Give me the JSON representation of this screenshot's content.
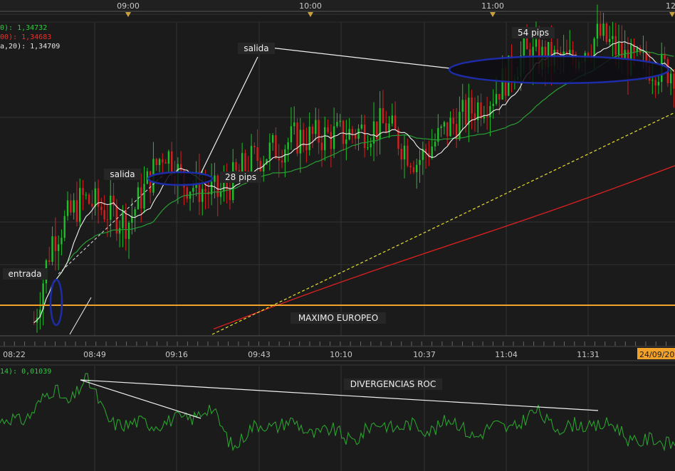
{
  "top_axis": {
    "ticks": [
      "09:00",
      "10:00",
      "11:00",
      "12"
    ]
  },
  "legend": [
    {
      "text": "0): 1,34732",
      "color": "#2ecc40"
    },
    {
      "text": "00): 1,34683",
      "color": "#e8322c"
    },
    {
      "text": "a,20): 1,34709",
      "color": "#e6e6e6"
    }
  ],
  "annotations": {
    "entrada": "entrada",
    "salida_1": "salida",
    "salida_2": "salida",
    "pips_28": "28 pips",
    "pips_54": "54 pips",
    "maximo": "MAXIMO EUROPEO",
    "divergencias": "DIVERGENCIAS ROC"
  },
  "bottom_axis": {
    "ticks": [
      "08:22",
      "08:49",
      "09:16",
      "09:43",
      "10:10",
      "10:37",
      "11:04",
      "11:31"
    ],
    "date_tag": "24/09/20"
  },
  "indicator": {
    "label": "14): 0,01039"
  },
  "colors": {
    "background": "#1b1b1b",
    "grid": "#333333",
    "bull": "#1fbf2a",
    "bear": "#d41f1f",
    "sma_fast": "#f2f2f2",
    "sma_mid": "#2a9d35",
    "sma_slow": "#d42020",
    "level": "#f2a22a",
    "roc": "#2aa12e",
    "ellipse": "#1d2ca8",
    "date_tag": "#f2a22a"
  },
  "chart_data": [
    {
      "type": "candlestick",
      "title": "",
      "x_ticks": [
        "08:22",
        "08:49",
        "09:16",
        "09:43",
        "10:10",
        "10:37",
        "11:04",
        "11:31"
      ],
      "top_ticks": [
        "09:00",
        "10:00",
        "11:00",
        "12"
      ],
      "price_path": [
        [
          "08:29",
          1.339
        ],
        [
          "08:35",
          1.3415
        ],
        [
          "08:45",
          1.3427
        ],
        [
          "09:00",
          1.342
        ],
        [
          "09:12",
          1.3442
        ],
        [
          "09:18",
          1.3432
        ],
        [
          "09:30",
          1.3428
        ],
        [
          "09:40",
          1.3438
        ],
        [
          "09:55",
          1.3445
        ],
        [
          "10:10",
          1.3446
        ],
        [
          "10:25",
          1.3449
        ],
        [
          "10:35",
          1.3438
        ],
        [
          "10:45",
          1.3448
        ],
        [
          "11:00",
          1.3458
        ],
        [
          "11:10",
          1.347
        ],
        [
          "11:25",
          1.3468
        ],
        [
          "11:35",
          1.3476
        ],
        [
          "11:45",
          1.3468
        ],
        [
          "11:55",
          1.3466
        ],
        [
          "12:02",
          1.3465
        ]
      ],
      "series": [
        {
          "name": "0)",
          "last": 1.34732
        },
        {
          "name": "00)",
          "last": 1.34683
        },
        {
          "name": "a,20)",
          "last": 1.34709
        }
      ],
      "annotations": [
        "entrada",
        "salida",
        "salida",
        "28 pips",
        "54 pips",
        "MAXIMO EUROPEO"
      ],
      "grid": true
    },
    {
      "type": "line",
      "series": [
        {
          "name": "14)",
          "last": 0.01039,
          "values": [
            [
              "08:24",
              -0.002
            ],
            [
              "08:30",
              0.003
            ],
            [
              "08:36",
              0.006
            ],
            [
              "08:40",
              0.004
            ],
            [
              "08:46",
              0.009
            ],
            [
              "08:53",
              0.0
            ],
            [
              "09:00",
              -0.004
            ],
            [
              "09:06",
              -0.001
            ],
            [
              "09:13",
              -0.003
            ],
            [
              "09:20",
              0.0
            ],
            [
              "09:27",
              0.001
            ],
            [
              "09:35",
              -0.008
            ],
            [
              "09:45",
              -0.002
            ],
            [
              "09:55",
              -0.003
            ],
            [
              "10:05",
              -0.005
            ],
            [
              "10:15",
              -0.006
            ],
            [
              "10:25",
              -0.002
            ],
            [
              "10:35",
              -0.004
            ],
            [
              "10:45",
              -0.002
            ],
            [
              "10:55",
              -0.005
            ],
            [
              "11:05",
              -0.003
            ],
            [
              "11:15",
              0.0
            ],
            [
              "11:25",
              -0.004
            ],
            [
              "11:35",
              -0.002
            ],
            [
              "11:45",
              -0.006
            ],
            [
              "11:55",
              -0.008
            ],
            [
              "12:02",
              -0.006
            ]
          ]
        }
      ],
      "annotations": [
        "DIVERGENCIAS ROC"
      ]
    }
  ]
}
